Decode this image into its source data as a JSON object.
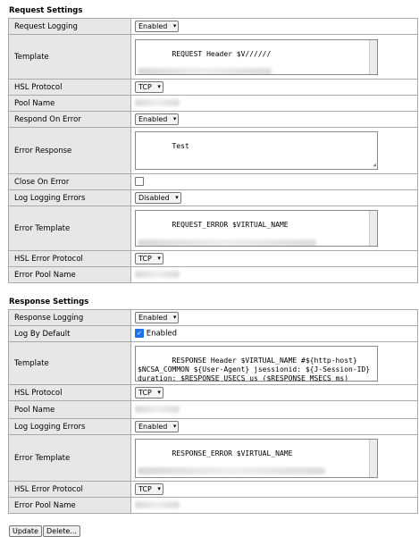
{
  "request": {
    "title": "Request Settings",
    "labels": {
      "request_logging": "Request Logging",
      "template": "Template",
      "hsl_protocol": "HSL Protocol",
      "pool_name": "Pool Name",
      "respond_on_error": "Respond On Error",
      "error_response": "Error Response",
      "close_on_error": "Close On Error",
      "log_logging_errors": "Log Logging Errors",
      "error_template": "Error Template",
      "hsl_error_protocol": "HSL Error Protocol",
      "error_pool_name": "Error Pool Name"
    },
    "request_logging_value": "Enabled",
    "template_value": "REQUEST Header $V//////",
    "hsl_protocol_value": "TCP",
    "respond_on_error_value": "Enabled",
    "error_response_value": "Test",
    "log_logging_errors_value": "Disabled",
    "error_template_value": "REQUEST_ERROR $VIRTUAL_NAME",
    "hsl_error_protocol_value": "TCP"
  },
  "response": {
    "title": "Response Settings",
    "labels": {
      "response_logging": "Response Logging",
      "log_by_default": "Log By Default",
      "template": "Template",
      "hsl_protocol": "HSL Protocol",
      "pool_name": "Pool Name",
      "log_logging_errors": "Log Logging Errors",
      "error_template": "Error Template",
      "hsl_error_protocol": "HSL Error Protocol",
      "error_pool_name": "Error Pool Name"
    },
    "response_logging_value": "Enabled",
    "log_by_default_label": "Enabled",
    "log_by_default_checked": true,
    "template_value": "RESPONSE Header $VIRTUAL_NAME #${http-host}\n$NCSA_COMMON ${User-Agent} jsessionid: ${J-Session-ID} duration: $RESPONSE_USECS us ($RESPONSE_MSECS ms)\nresponse_size: $RESPONSE_SIZE node:",
    "hsl_protocol_value": "TCP",
    "log_logging_errors_value": "Enabled",
    "error_template_value": "RESPONSE_ERROR $VIRTUAL_NAME",
    "hsl_error_protocol_value": "TCP"
  },
  "buttons": {
    "update": "Update",
    "delete": "Delete..."
  },
  "colors": {
    "label_bg": "#e7e7e7",
    "value_bg": "#ffffff",
    "border": "#aaaaaa",
    "checkbox_accent": "#1a73e8"
  }
}
